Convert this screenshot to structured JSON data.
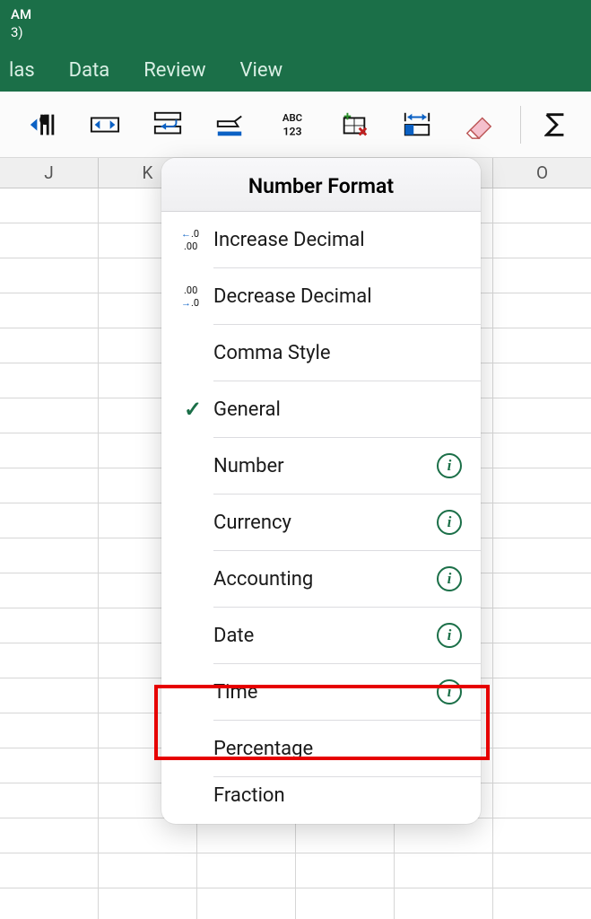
{
  "titlebar": {
    "line1": "AM",
    "line2": "3)"
  },
  "menubar": {
    "items": [
      {
        "label": "las"
      },
      {
        "label": "Data"
      },
      {
        "label": "Review"
      },
      {
        "label": "View"
      }
    ]
  },
  "columns": [
    "J",
    "K",
    "",
    "",
    "",
    "O"
  ],
  "popover": {
    "title": "Number Format",
    "items": [
      {
        "label": "Increase Decimal",
        "icon": "increase-decimal",
        "checked": false,
        "info": false
      },
      {
        "label": "Decrease Decimal",
        "icon": "decrease-decimal",
        "checked": false,
        "info": false
      },
      {
        "label": "Comma Style",
        "icon": "",
        "checked": false,
        "info": false
      },
      {
        "label": "General",
        "icon": "",
        "checked": true,
        "info": false
      },
      {
        "label": "Number",
        "icon": "",
        "checked": false,
        "info": true
      },
      {
        "label": "Currency",
        "icon": "",
        "checked": false,
        "info": true
      },
      {
        "label": "Accounting",
        "icon": "",
        "checked": false,
        "info": true
      },
      {
        "label": "Date",
        "icon": "",
        "checked": false,
        "info": true
      },
      {
        "label": "Time",
        "icon": "",
        "checked": false,
        "info": true
      },
      {
        "label": "Percentage",
        "icon": "",
        "checked": false,
        "info": false
      },
      {
        "label": "Fraction",
        "icon": "",
        "checked": false,
        "info": false
      }
    ]
  }
}
